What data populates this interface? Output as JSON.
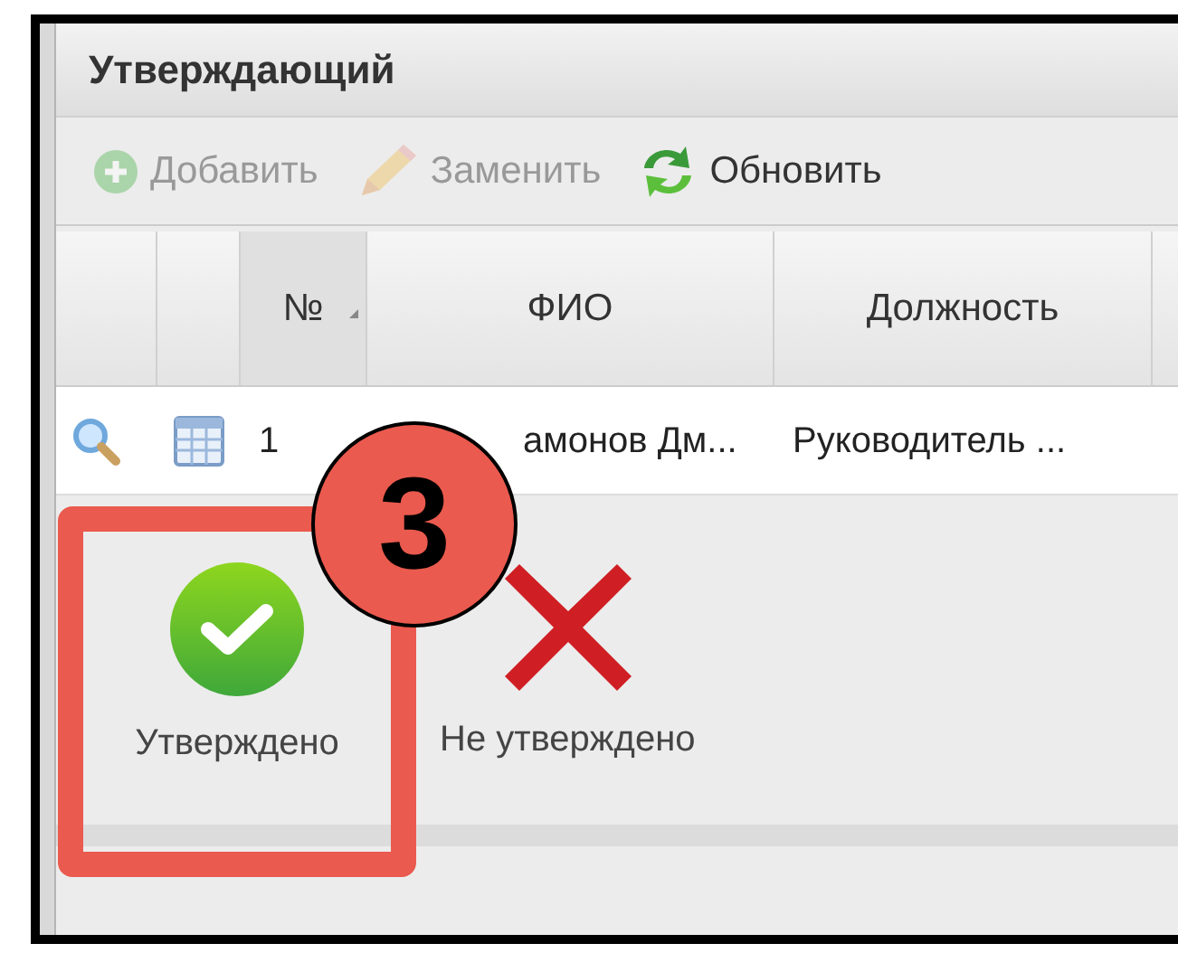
{
  "panel": {
    "title": "Утверждающий"
  },
  "toolbar": [
    {
      "label": "Добавить",
      "kind": "add",
      "disabled": true
    },
    {
      "label": "Заменить",
      "kind": "edit",
      "disabled": true
    },
    {
      "label": "Обновить",
      "kind": "refresh",
      "disabled": false
    }
  ],
  "table": {
    "columns": [
      {
        "kind": "view"
      },
      {
        "kind": "details"
      },
      {
        "label": "№",
        "kind": "text",
        "sorted": true
      },
      {
        "label": "ФИО",
        "kind": "text",
        "sorted": false
      },
      {
        "label": "Должность",
        "kind": "text",
        "sorted": false
      }
    ],
    "rows": [
      {
        "cells": [
          "",
          "",
          "1",
          "амонов Дм...",
          "Руководитель ..."
        ]
      }
    ]
  },
  "decision_buttons": [
    {
      "label": "Утверждено",
      "kind": "approve"
    },
    {
      "label": "Не утверждено",
      "kind": "reject"
    }
  ],
  "annotation": {
    "number": "3"
  }
}
